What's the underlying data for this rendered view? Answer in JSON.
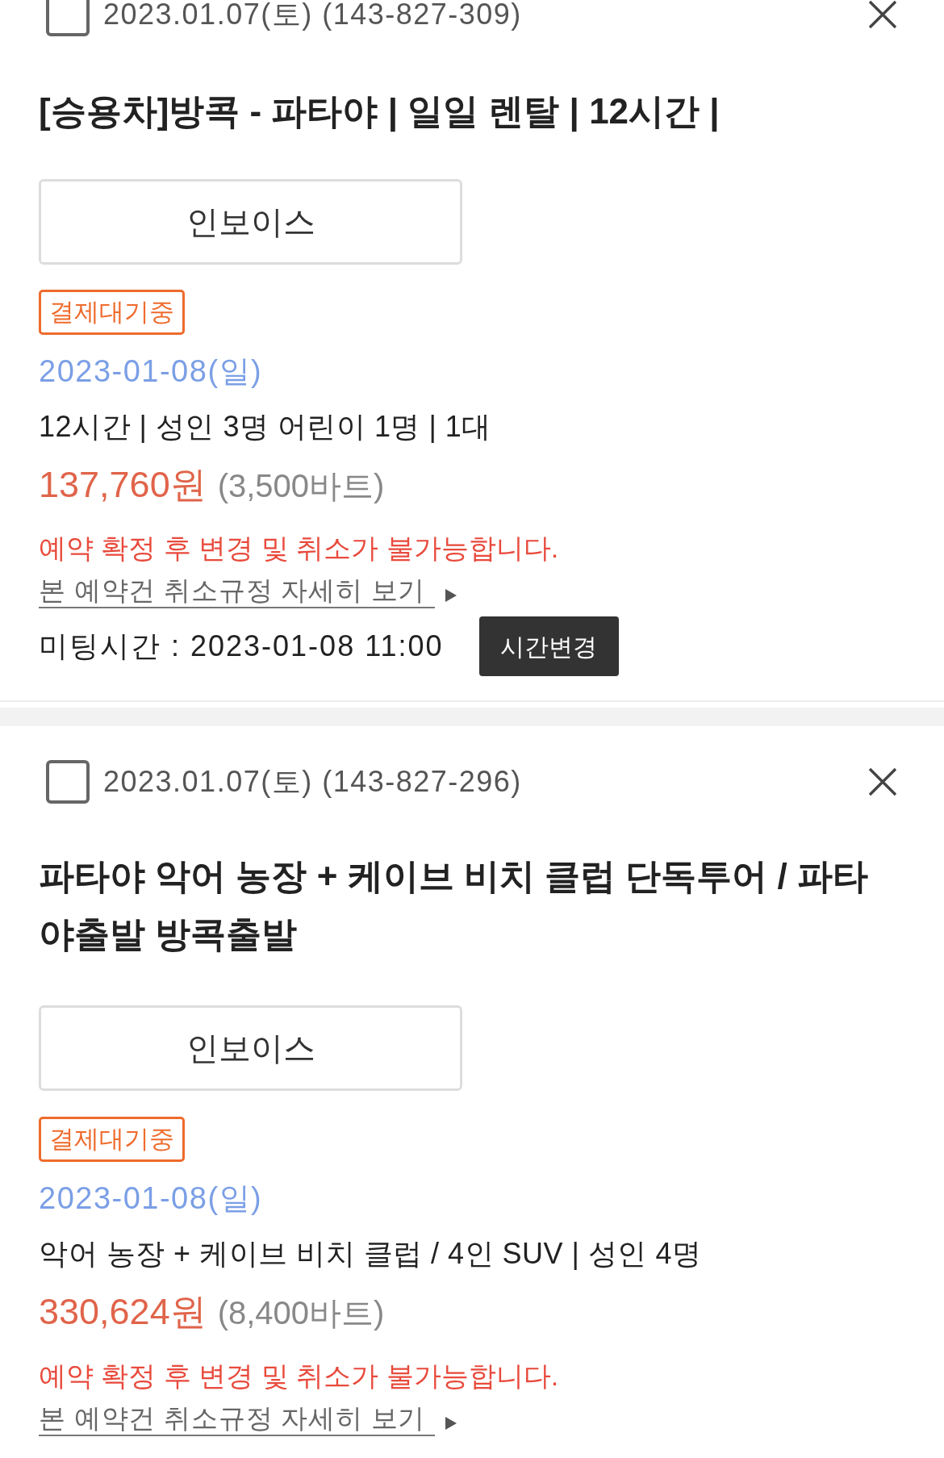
{
  "bookings": [
    {
      "checked": false,
      "header": "2023.01.07(토) (143-827-309)",
      "title": "[승용차]방콕 - 파타야 | 일일 렌탈 | 12시간 |",
      "invoice_button": "인보이스",
      "status_badge": "결제대기중",
      "date": "2023-01-08(일)",
      "details": "12시간 | 성인 3명 어린이 1명 | 1대",
      "price": "137,760원",
      "price_baht": "(3,500바트)",
      "notice": "예약 확정 후 변경 및 취소가 불가능합니다.",
      "policy_link": "본 예약건 취소규정 자세히 보기",
      "meeting": {
        "label": "미팅시간 : 2023-01-08 11:00",
        "button": "시간변경"
      }
    },
    {
      "checked": false,
      "header": "2023.01.07(토) (143-827-296)",
      "title": "파타야 악어 농장 + 케이브 비치 클럽 단독투어 / 파타야출발 방콕출발",
      "invoice_button": "인보이스",
      "status_badge": "결제대기중",
      "date": "2023-01-08(일)",
      "details": "악어 농장 + 케이브 비치 클럽 / 4인 SUV | 성인 4명",
      "price": "330,624원",
      "price_baht": "(8,400바트)",
      "notice": "예약 확정 후 변경 및 취소가 불가능합니다.",
      "policy_link": "본 예약건 취소규정 자세히 보기"
    }
  ]
}
